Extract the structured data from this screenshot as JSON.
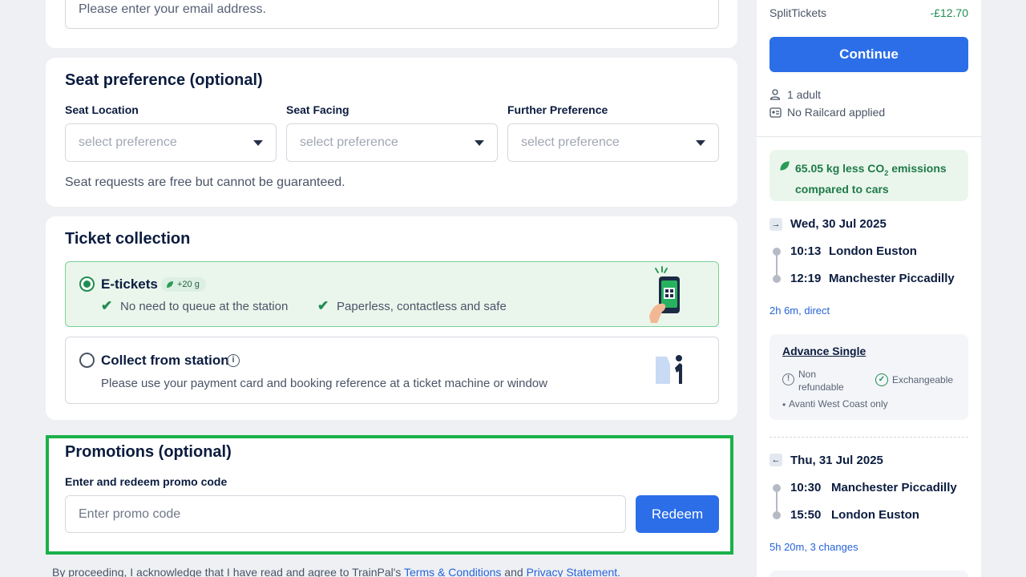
{
  "contact": {
    "email_placeholder": "Please enter your email address."
  },
  "seat": {
    "title": "Seat preference (optional)",
    "location_label": "Seat Location",
    "facing_label": "Seat Facing",
    "further_label": "Further Preference",
    "select_placeholder": "select preference",
    "note": "Seat requests are free but cannot be guaranteed."
  },
  "collection": {
    "title": "Ticket collection",
    "eticket": {
      "label": "E-tickets",
      "badge": "+20 g",
      "benefit1": "No need to queue at the station",
      "benefit2": "Paperless, contactless and safe"
    },
    "station": {
      "label": "Collect from station",
      "desc": "Please use your payment card and booking reference at a ticket machine or window"
    }
  },
  "promo": {
    "title": "Promotions (optional)",
    "label": "Enter and redeem promo code",
    "placeholder": "Enter promo code",
    "button": "Redeem"
  },
  "footer": {
    "prefix": "By proceeding, I acknowledge that I have read and agree to TrainPal's ",
    "terms": "Terms & Conditions",
    "and": " and ",
    "privacy": "Privacy Statement."
  },
  "summary": {
    "split_label": "SplitTickets",
    "split_value": "-£12.70",
    "continue": "Continue",
    "passengers": "1 adult",
    "railcard": "No Railcard applied",
    "co2_line1": "65.05 kg less CO",
    "co2_sub": "2",
    "co2_line1_end": " emissions",
    "co2_line2": "compared to cars",
    "outbound": {
      "date": "Wed, 30 Jul 2025",
      "dep_time": "10:13",
      "dep_station": "London Euston",
      "arr_time": "12:19",
      "arr_station": "Manchester Piccadilly",
      "duration": "2h 6m, direct"
    },
    "fare": {
      "name": "Advance Single",
      "refund": "Non refundable",
      "exchange": "Exchangeable",
      "operator": "Avanti West Coast only"
    },
    "return": {
      "date": "Thu, 31 Jul 2025",
      "dep_time": "10:30",
      "dep_station": "Manchester Piccadilly",
      "arr_time": "15:50",
      "arr_station": "London Euston",
      "duration": "5h 20m, 3 changes"
    }
  },
  "colors": {
    "accent": "#2b6ee8",
    "green": "#1f8d52",
    "highlight": "#1ab14a"
  }
}
